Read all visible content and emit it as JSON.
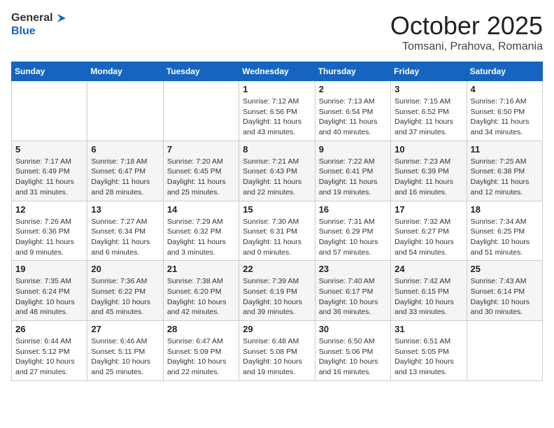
{
  "header": {
    "logo_general": "General",
    "logo_blue": "Blue",
    "month": "October 2025",
    "location": "Tomsani, Prahova, Romania"
  },
  "days_of_week": [
    "Sunday",
    "Monday",
    "Tuesday",
    "Wednesday",
    "Thursday",
    "Friday",
    "Saturday"
  ],
  "weeks": [
    [
      {
        "day": "",
        "info": ""
      },
      {
        "day": "",
        "info": ""
      },
      {
        "day": "",
        "info": ""
      },
      {
        "day": "1",
        "info": "Sunrise: 7:12 AM\nSunset: 6:56 PM\nDaylight: 11 hours and 43 minutes."
      },
      {
        "day": "2",
        "info": "Sunrise: 7:13 AM\nSunset: 6:54 PM\nDaylight: 11 hours and 40 minutes."
      },
      {
        "day": "3",
        "info": "Sunrise: 7:15 AM\nSunset: 6:52 PM\nDaylight: 11 hours and 37 minutes."
      },
      {
        "day": "4",
        "info": "Sunrise: 7:16 AM\nSunset: 6:50 PM\nDaylight: 11 hours and 34 minutes."
      }
    ],
    [
      {
        "day": "5",
        "info": "Sunrise: 7:17 AM\nSunset: 6:49 PM\nDaylight: 11 hours and 31 minutes."
      },
      {
        "day": "6",
        "info": "Sunrise: 7:18 AM\nSunset: 6:47 PM\nDaylight: 11 hours and 28 minutes."
      },
      {
        "day": "7",
        "info": "Sunrise: 7:20 AM\nSunset: 6:45 PM\nDaylight: 11 hours and 25 minutes."
      },
      {
        "day": "8",
        "info": "Sunrise: 7:21 AM\nSunset: 6:43 PM\nDaylight: 11 hours and 22 minutes."
      },
      {
        "day": "9",
        "info": "Sunrise: 7:22 AM\nSunset: 6:41 PM\nDaylight: 11 hours and 19 minutes."
      },
      {
        "day": "10",
        "info": "Sunrise: 7:23 AM\nSunset: 6:39 PM\nDaylight: 11 hours and 16 minutes."
      },
      {
        "day": "11",
        "info": "Sunrise: 7:25 AM\nSunset: 6:38 PM\nDaylight: 11 hours and 12 minutes."
      }
    ],
    [
      {
        "day": "12",
        "info": "Sunrise: 7:26 AM\nSunset: 6:36 PM\nDaylight: 11 hours and 9 minutes."
      },
      {
        "day": "13",
        "info": "Sunrise: 7:27 AM\nSunset: 6:34 PM\nDaylight: 11 hours and 6 minutes."
      },
      {
        "day": "14",
        "info": "Sunrise: 7:29 AM\nSunset: 6:32 PM\nDaylight: 11 hours and 3 minutes."
      },
      {
        "day": "15",
        "info": "Sunrise: 7:30 AM\nSunset: 6:31 PM\nDaylight: 11 hours and 0 minutes."
      },
      {
        "day": "16",
        "info": "Sunrise: 7:31 AM\nSunset: 6:29 PM\nDaylight: 10 hours and 57 minutes."
      },
      {
        "day": "17",
        "info": "Sunrise: 7:32 AM\nSunset: 6:27 PM\nDaylight: 10 hours and 54 minutes."
      },
      {
        "day": "18",
        "info": "Sunrise: 7:34 AM\nSunset: 6:25 PM\nDaylight: 10 hours and 51 minutes."
      }
    ],
    [
      {
        "day": "19",
        "info": "Sunrise: 7:35 AM\nSunset: 6:24 PM\nDaylight: 10 hours and 48 minutes."
      },
      {
        "day": "20",
        "info": "Sunrise: 7:36 AM\nSunset: 6:22 PM\nDaylight: 10 hours and 45 minutes."
      },
      {
        "day": "21",
        "info": "Sunrise: 7:38 AM\nSunset: 6:20 PM\nDaylight: 10 hours and 42 minutes."
      },
      {
        "day": "22",
        "info": "Sunrise: 7:39 AM\nSunset: 6:19 PM\nDaylight: 10 hours and 39 minutes."
      },
      {
        "day": "23",
        "info": "Sunrise: 7:40 AM\nSunset: 6:17 PM\nDaylight: 10 hours and 36 minutes."
      },
      {
        "day": "24",
        "info": "Sunrise: 7:42 AM\nSunset: 6:15 PM\nDaylight: 10 hours and 33 minutes."
      },
      {
        "day": "25",
        "info": "Sunrise: 7:43 AM\nSunset: 6:14 PM\nDaylight: 10 hours and 30 minutes."
      }
    ],
    [
      {
        "day": "26",
        "info": "Sunrise: 6:44 AM\nSunset: 5:12 PM\nDaylight: 10 hours and 27 minutes."
      },
      {
        "day": "27",
        "info": "Sunrise: 6:46 AM\nSunset: 5:11 PM\nDaylight: 10 hours and 25 minutes."
      },
      {
        "day": "28",
        "info": "Sunrise: 6:47 AM\nSunset: 5:09 PM\nDaylight: 10 hours and 22 minutes."
      },
      {
        "day": "29",
        "info": "Sunrise: 6:48 AM\nSunset: 5:08 PM\nDaylight: 10 hours and 19 minutes."
      },
      {
        "day": "30",
        "info": "Sunrise: 6:50 AM\nSunset: 5:06 PM\nDaylight: 10 hours and 16 minutes."
      },
      {
        "day": "31",
        "info": "Sunrise: 6:51 AM\nSunset: 5:05 PM\nDaylight: 10 hours and 13 minutes."
      },
      {
        "day": "",
        "info": ""
      }
    ]
  ]
}
